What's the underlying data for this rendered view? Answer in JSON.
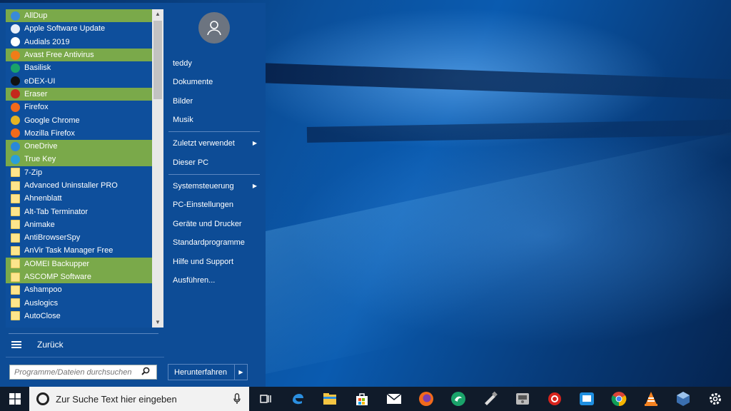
{
  "programs": [
    {
      "label": "AllDup",
      "icon": "alldup-icon",
      "color": "#3a8ad8",
      "highlighted": true
    },
    {
      "label": "Apple Software Update",
      "icon": "apple-update-icon",
      "color": "#e8eef8",
      "highlighted": false
    },
    {
      "label": "Audials 2019",
      "icon": "audials-icon",
      "color": "#ffffff",
      "highlighted": false
    },
    {
      "label": "Avast Free Antivirus",
      "icon": "avast-icon",
      "color": "#f07c18",
      "highlighted": true
    },
    {
      "label": "Basilisk",
      "icon": "basilisk-icon",
      "color": "#1aa36a",
      "highlighted": false
    },
    {
      "label": "eDEX-UI",
      "icon": "edex-icon",
      "color": "#111111",
      "highlighted": false
    },
    {
      "label": "Eraser",
      "icon": "eraser-icon",
      "color": "#c4281c",
      "highlighted": true
    },
    {
      "label": "Firefox",
      "icon": "firefox-icon",
      "color": "#f26a1b",
      "highlighted": false
    },
    {
      "label": "Google Chrome",
      "icon": "chrome-icon",
      "color": "#e4b423",
      "highlighted": false
    },
    {
      "label": "Mozilla Firefox",
      "icon": "firefox-icon",
      "color": "#f26a1b",
      "highlighted": false
    },
    {
      "label": "OneDrive",
      "icon": "onedrive-icon",
      "color": "#2a88d8",
      "highlighted": true
    },
    {
      "label": "True Key",
      "icon": "truekey-icon",
      "color": "#2a9fd8",
      "highlighted": true
    },
    {
      "label": "7-Zip",
      "icon": "folder-icon",
      "color": "#fde58c",
      "highlighted": false
    },
    {
      "label": "Advanced Uninstaller PRO",
      "icon": "folder-icon",
      "color": "#fde58c",
      "highlighted": false
    },
    {
      "label": "Ahnenblatt",
      "icon": "folder-icon",
      "color": "#fde58c",
      "highlighted": false
    },
    {
      "label": "Alt-Tab Terminator",
      "icon": "folder-icon",
      "color": "#fde58c",
      "highlighted": false
    },
    {
      "label": "Animake",
      "icon": "folder-icon",
      "color": "#fde58c",
      "highlighted": false
    },
    {
      "label": "AntiBrowserSpy",
      "icon": "folder-icon",
      "color": "#fde58c",
      "highlighted": false
    },
    {
      "label": "AnVir Task Manager Free",
      "icon": "folder-icon",
      "color": "#fde58c",
      "highlighted": false
    },
    {
      "label": "AOMEI Backupper",
      "icon": "folder-icon",
      "color": "#fde58c",
      "highlighted": true
    },
    {
      "label": "ASCOMP Software",
      "icon": "folder-icon",
      "color": "#fde58c",
      "highlighted": true
    },
    {
      "label": "Ashampoo",
      "icon": "folder-icon",
      "color": "#fde58c",
      "highlighted": false
    },
    {
      "label": "Auslogics",
      "icon": "folder-icon",
      "color": "#fde58c",
      "highlighted": false
    },
    {
      "label": "AutoClose",
      "icon": "folder-icon",
      "color": "#fde58c",
      "highlighted": false
    }
  ],
  "left": {
    "back_label": "Zurück",
    "search_placeholder": "Programme/Dateien durchsuchen"
  },
  "right": {
    "user": "teddy",
    "documents": "Dokumente",
    "pictures": "Bilder",
    "music": "Musik",
    "recent": "Zuletzt verwendet",
    "this_pc": "Dieser PC",
    "control_panel": "Systemsteuerung",
    "pc_settings": "PC-Einstellungen",
    "devices": "Geräte und Drucker",
    "default_programs": "Standardprogramme",
    "help": "Hilfe und Support",
    "run": "Ausführen...",
    "shutdown": "Herunterfahren"
  },
  "taskbar": {
    "search_placeholder": "Zur Suche Text hier eingeben",
    "icons": [
      "task-view-icon",
      "edge-icon",
      "file-explorer-icon",
      "store-icon",
      "mail-icon",
      "firefox-icon",
      "basilisk-icon",
      "tool-icon",
      "disk-icon",
      "avast-red-icon",
      "sandbox-icon",
      "chrome-icon",
      "vlc-icon",
      "virtualbox-icon",
      "settings-gear-icon"
    ]
  },
  "colors": {
    "menu_bg": "#0d4c96",
    "highlight": "#7aa94a",
    "taskbar_bg": "#101b2a"
  }
}
